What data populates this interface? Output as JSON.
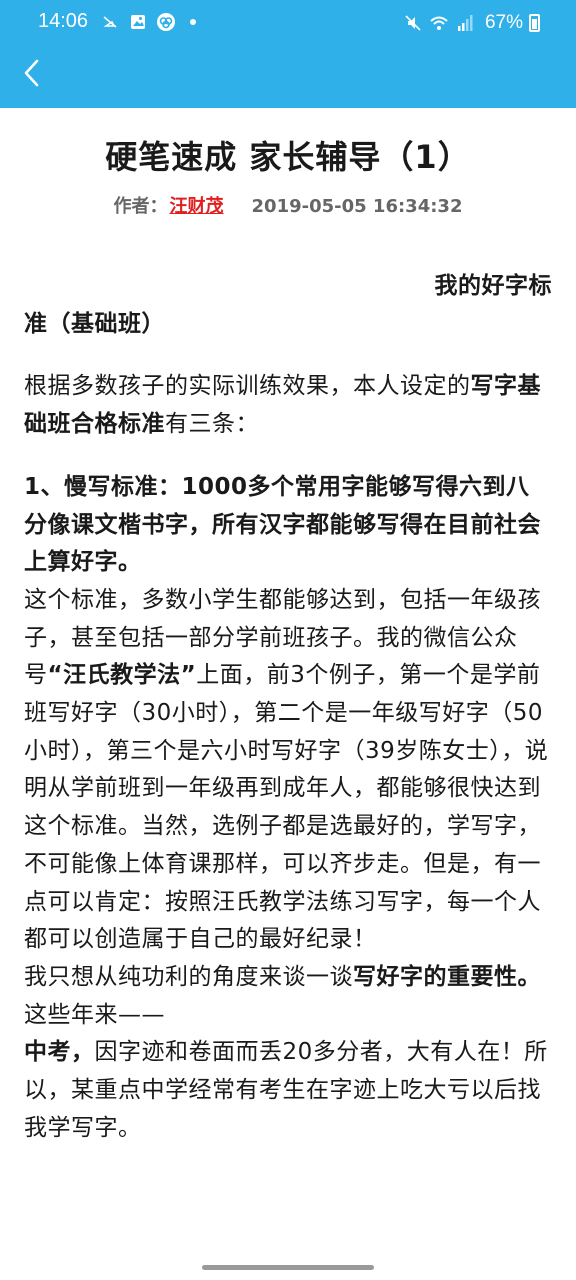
{
  "status_bar": {
    "time": "14:06",
    "battery": "67%",
    "left_icons": [
      "no-call-icon",
      "image-icon",
      "app-icon",
      "notification-dot"
    ],
    "right_icons": [
      "mute-icon",
      "wifi-icon",
      "signal-icon",
      "battery-icon"
    ]
  },
  "header": {
    "background": "#2fb0e8",
    "back_icon": "chevron-left-icon"
  },
  "article": {
    "title": "硬笔速成 家长辅导（1）",
    "author_label": "作者：",
    "author_name": "汪财茂",
    "date": "2019-05-05 16:34:32",
    "section_title_part1": "我的好字标",
    "section_title_part2": "准（基础班）",
    "p1_text": "根据多数孩子的实际训练效果，本人设定的",
    "p1_bold": "写字基础班合格标准",
    "p1_tail": "有三条：",
    "p2_bold": "1、慢写标准：1000多个常用字能够写得六到八分像课文楷书字，所有汉字都能够写得在目前社会上算好字。",
    "p3_text1": "这个标准，多数小学生都能够达到，包括一年级孩子，甚至包括一部分学前班孩子。我的微信公众号",
    "p3_bold": "“汪氏教学法”",
    "p3_text2": "上面，前3个例子，第一个是学前班写好字（30小时），第二个是一年级写好字（50小时），第三个是六小时写好字（39岁陈女士），说明从学前班到一年级再到成年人，都能够很快达到这个标准。当然，选例子都是选最好的，学写字，不可能像上体育课那样，可以齐步走。但是，有一点可以肯定：按照汪氏教学法练习写字，每一个人都可以创造属于自己的最好纪录！",
    "p4_text": "我只想从纯功利的角度来谈一谈",
    "p4_bold": "写好字的重要性。",
    "p4_tail": "这些年来——",
    "p5_bold": "中考，",
    "p5_text": "因字迹和卷面而丢20多分者，大有人在！所以，某重点中学经常有考生在字迹上吃大亏以后找我学写字。"
  }
}
